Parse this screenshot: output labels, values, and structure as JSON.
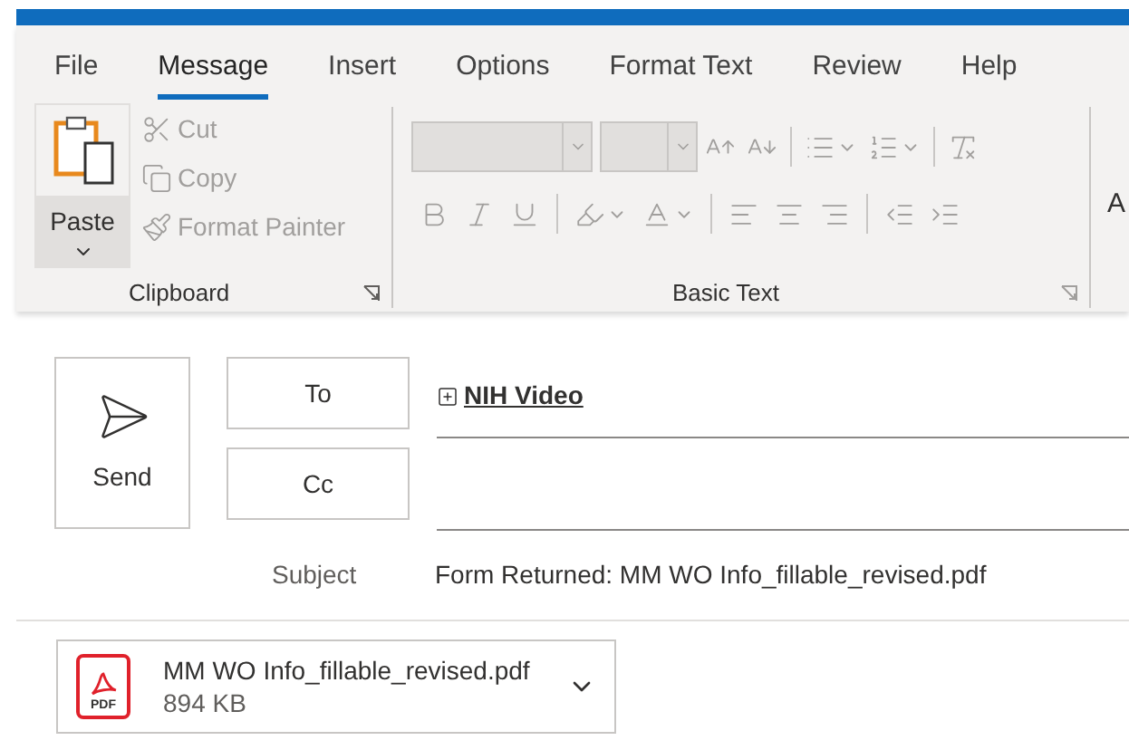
{
  "tabs": [
    {
      "label": "File",
      "selected": false
    },
    {
      "label": "Message",
      "selected": true
    },
    {
      "label": "Insert",
      "selected": false
    },
    {
      "label": "Options",
      "selected": false
    },
    {
      "label": "Format Text",
      "selected": false
    },
    {
      "label": "Review",
      "selected": false
    },
    {
      "label": "Help",
      "selected": false
    }
  ],
  "clipboard": {
    "title": "Clipboard",
    "paste": "Paste",
    "items": [
      {
        "kind": "cut",
        "label": "Cut",
        "disabled": true
      },
      {
        "kind": "copy",
        "label": "Copy",
        "disabled": true
      },
      {
        "kind": "format_painter",
        "label": "Format Painter",
        "disabled": true
      }
    ]
  },
  "basic_text": {
    "title": "Basic Text",
    "disabled": true
  },
  "next_group": {
    "label": "A"
  },
  "compose": {
    "send": "Send",
    "to": {
      "button": "To",
      "recipients": [
        "NIH Video"
      ]
    },
    "cc": {
      "button": "Cc"
    },
    "subject": {
      "label": "Subject",
      "value": "Form Returned: MM WO Info_fillable_revised.pdf"
    }
  },
  "attachments": [
    {
      "name": "MM WO Info_fillable_revised.pdf",
      "size": "894 KB",
      "type": "PDF"
    }
  ]
}
